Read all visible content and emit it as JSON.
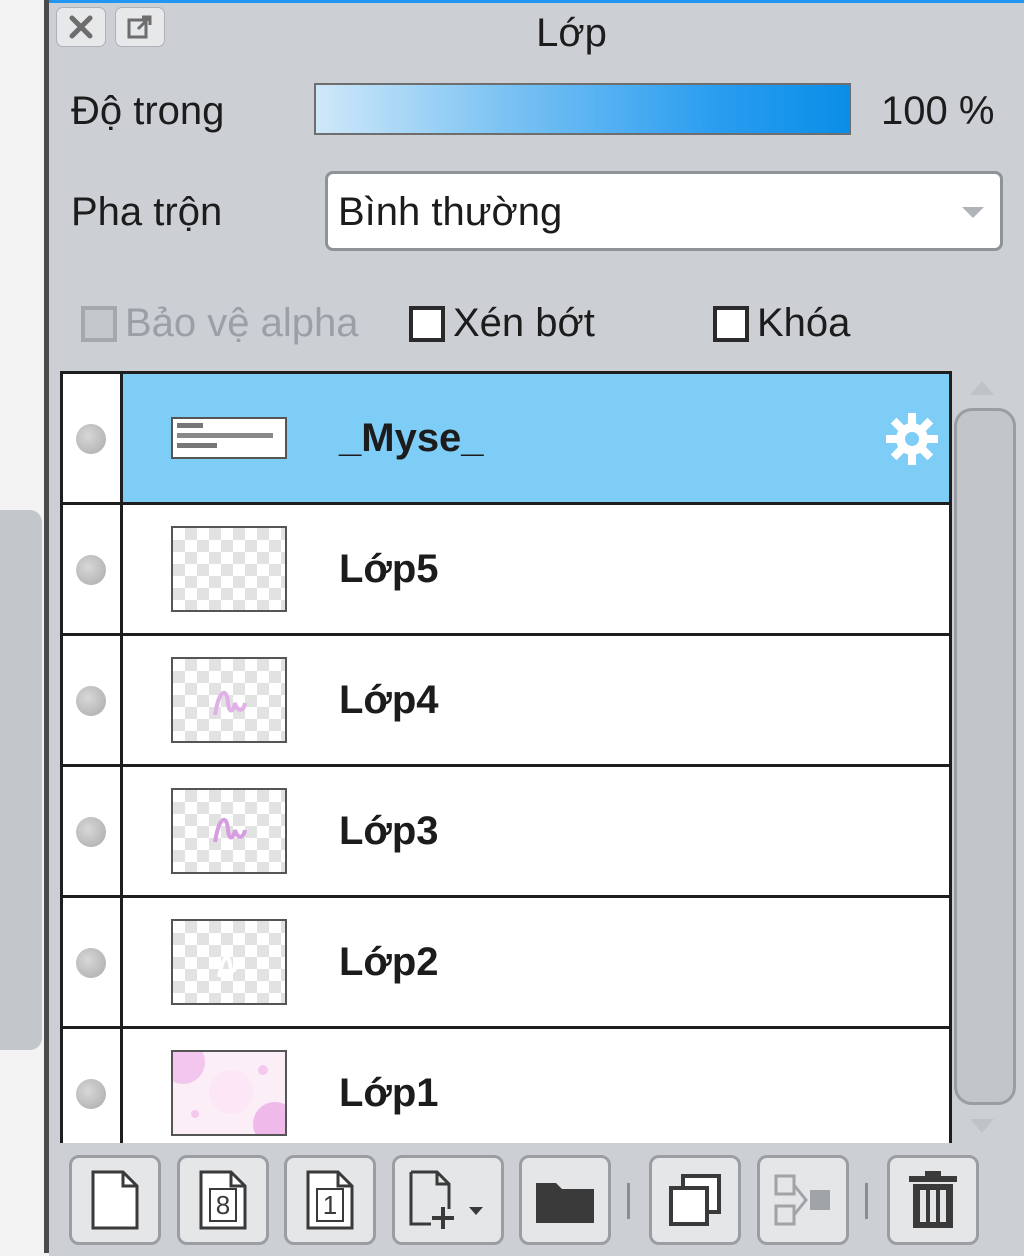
{
  "panel": {
    "title": "Lớp",
    "opacity_label": "Độ trong",
    "opacity_value": "100 %",
    "opacity_fraction": 1.0,
    "blend_label": "Pha trộn",
    "blend_value": "Bình thường",
    "accent_color": "#2196f3",
    "selected_color": "#7ecdf7"
  },
  "checkboxes": [
    {
      "label": "Bảo vệ alpha",
      "checked": false,
      "disabled": true
    },
    {
      "label": "Xén bớt",
      "checked": false,
      "disabled": false
    },
    {
      "label": "Khóa",
      "checked": false,
      "disabled": false
    }
  ],
  "layers": [
    {
      "name": "_Myse_",
      "selected": true,
      "thumb": "text-thumb",
      "has_settings_icon": true
    },
    {
      "name": "Lớp5",
      "selected": false,
      "thumb": "transparent"
    },
    {
      "name": "Lớp4",
      "selected": false,
      "thumb": "pink-text"
    },
    {
      "name": "Lớp3",
      "selected": false,
      "thumb": "pink-text"
    },
    {
      "name": "Lớp2",
      "selected": false,
      "thumb": "white-text"
    },
    {
      "name": "Lớp1",
      "selected": false,
      "thumb": "pink-pattern"
    }
  ],
  "toolbar": {
    "buttons": [
      "new-layer-icon",
      "new-8bit-layer-icon",
      "new-1bit-layer-icon",
      "new-layer-menu-icon",
      "new-folder-icon",
      "duplicate-layer-icon",
      "merge-down-icon",
      "trash-icon"
    ],
    "page_8_label": "8",
    "page_1_label": "1"
  }
}
